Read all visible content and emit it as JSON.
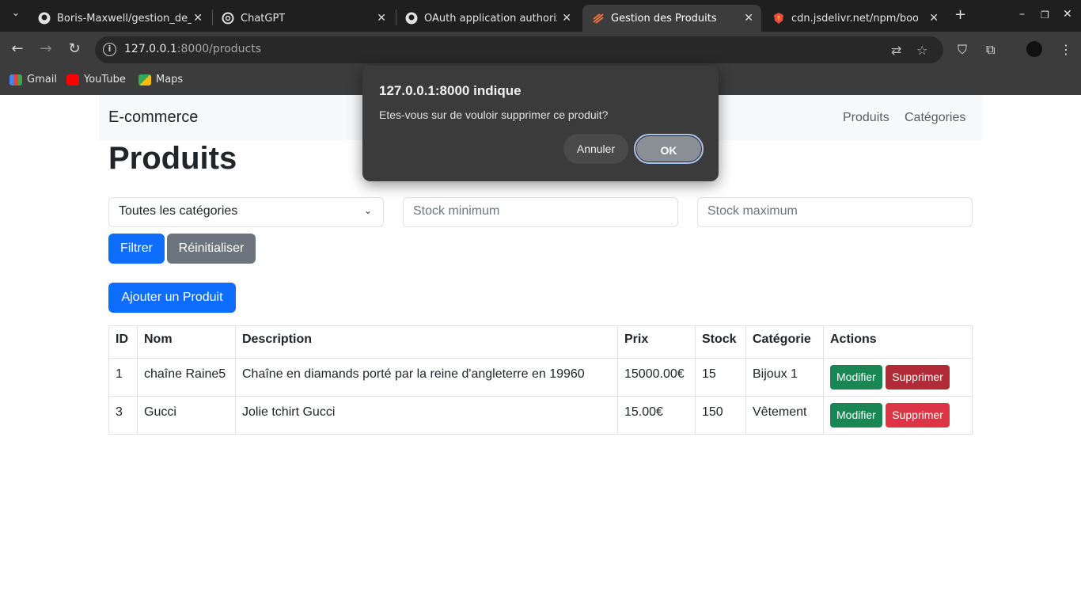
{
  "browser": {
    "tabs": [
      {
        "title": "Boris-Maxwell/gestion_de_",
        "icon": "github-icon"
      },
      {
        "title": "ChatGPT",
        "icon": "chatgpt-icon"
      },
      {
        "title": "OAuth application authoriz",
        "icon": "github-icon"
      },
      {
        "title": "Gestion des Produits",
        "icon": "site-icon",
        "active": true
      },
      {
        "title": "cdn.jsdelivr.net/npm/boots",
        "icon": "jsdelivr-icon"
      }
    ],
    "url_host": "127.0.0.1",
    "url_rest": ":8000/products",
    "bookmarks": [
      "Gmail",
      "YouTube",
      "Maps"
    ]
  },
  "navbar": {
    "brand": "E-commerce",
    "links": [
      "Produits",
      "Catégories"
    ]
  },
  "main": {
    "title": "Produits",
    "filters": {
      "category_value": "Toutes les catégories",
      "stock_min_placeholder": "Stock minimum",
      "stock_max_placeholder": "Stock maximum",
      "filter_label": "Filtrer",
      "reset_label": "Réinitialiser"
    },
    "add_label": "Ajouter un Produit",
    "table": {
      "headers": [
        "ID",
        "Nom",
        "Description",
        "Prix",
        "Stock",
        "Catégorie",
        "Actions"
      ],
      "rows": [
        {
          "id": "1",
          "nom": "chaîne Raine5",
          "description": "Chaîne en diamands porté par la reine d'angleterre en 19960",
          "prix": "15000.00€",
          "stock": "15",
          "categorie": "Bijoux 1"
        },
        {
          "id": "3",
          "nom": "Gucci",
          "description": "Jolie tchirt Gucci",
          "prix": "15.00€",
          "stock": "150",
          "categorie": "Vêtement"
        }
      ],
      "edit_label": "Modifier",
      "delete_label": "Supprimer"
    }
  },
  "dialog": {
    "title": "127.0.0.1:8000 indique",
    "message": "Etes-vous sur de vouloir supprimer ce produit?",
    "cancel_label": "Annuler",
    "ok_label": "OK"
  },
  "colors": {
    "primary": "#0d6efd",
    "secondary": "#6c757d",
    "success": "#198754",
    "danger": "#dc3545"
  }
}
